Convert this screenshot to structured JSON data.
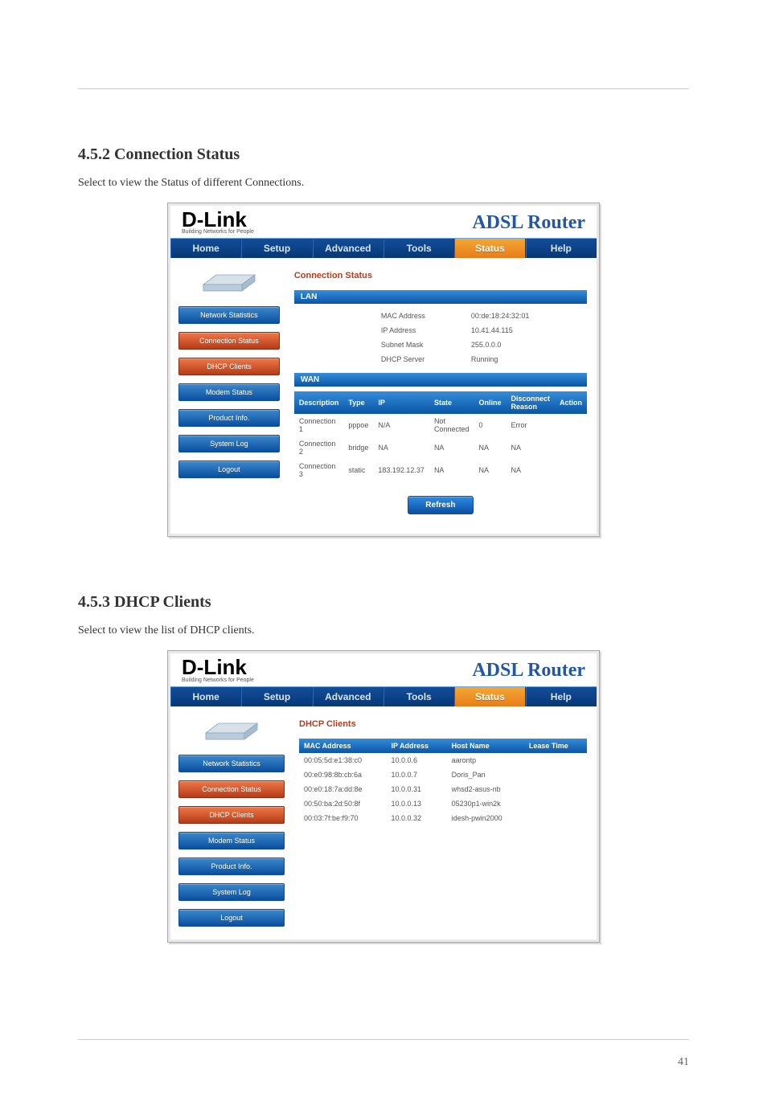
{
  "page": {
    "footer_page_number": "41"
  },
  "doc": {
    "section1": {
      "title": "4.5.2 Connection Status",
      "desc": "Select to view the Status of different Connections."
    },
    "section2": {
      "title": "4.5.3 DHCP Clients",
      "desc": "Select to view the list of DHCP clients."
    }
  },
  "router": {
    "logo_main": "D-Link",
    "logo_sub": "Building Networks for People",
    "banner": "ADSL Router",
    "tabs": [
      "Home",
      "Setup",
      "Advanced",
      "Tools",
      "Status",
      "Help"
    ]
  },
  "sidebar_items": [
    "Network Statistics",
    "Connection Status",
    "DHCP Clients",
    "Modem Status",
    "Product Info.",
    "System Log",
    "Logout"
  ],
  "conn_status": {
    "title": "Connection Status",
    "lan_label": "LAN",
    "lan": [
      {
        "k": "MAC Address",
        "v": "00:de:18:24:32:01"
      },
      {
        "k": "IP Address",
        "v": "10.41.44.115"
      },
      {
        "k": "Subnet Mask",
        "v": "255.0.0.0"
      },
      {
        "k": "DHCP Server",
        "v": "Running"
      }
    ],
    "wan_label": "WAN",
    "wan_headers": [
      "Description",
      "Type",
      "IP",
      "State",
      "Online",
      "Disconnect Reason",
      "Action"
    ],
    "wan_rows": [
      {
        "desc": "Connection 1",
        "type": "pppoe",
        "ip": "N/A",
        "state": "Not Connected",
        "online": "0",
        "reason": "Error",
        "action": ""
      },
      {
        "desc": "Connection 2",
        "type": "bridge",
        "ip": "NA",
        "state": "NA",
        "online": "NA",
        "reason": "NA",
        "action": ""
      },
      {
        "desc": "Connection 3",
        "type": "static",
        "ip": "183.192.12.37",
        "state": "NA",
        "online": "NA",
        "reason": "NA",
        "action": ""
      }
    ],
    "refresh": "Refresh"
  },
  "dhcp_clients": {
    "title": "DHCP Clients",
    "headers": [
      "MAC Address",
      "IP Address",
      "Host Name",
      "Lease Time"
    ],
    "rows": [
      {
        "mac": "00:05:5d:e1:38:c0",
        "ip": "10.0.0.6",
        "host": "aarontp",
        "lease": ""
      },
      {
        "mac": "00:e0:98:8b:cb:6a",
        "ip": "10.0.0.7",
        "host": "Doris_Pan",
        "lease": ""
      },
      {
        "mac": "00:e0:18:7a:dd:8e",
        "ip": "10.0.0.31",
        "host": "whsd2-asus-nb",
        "lease": ""
      },
      {
        "mac": "00:50:ba:2d:50:8f",
        "ip": "10.0.0.13",
        "host": "05230p1-win2k",
        "lease": ""
      },
      {
        "mac": "00:03:7f:be:f9:70",
        "ip": "10.0.0.32",
        "host": "idesh-pwin2000",
        "lease": ""
      }
    ]
  }
}
